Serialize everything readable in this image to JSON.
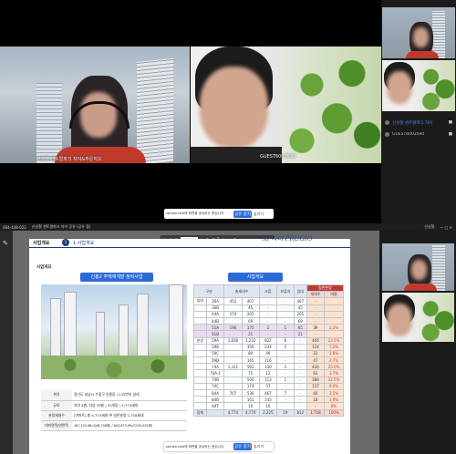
{
  "participants": {
    "main_left": {
      "name": "신성철 센트럴파크 자이&주은지오"
    },
    "main_right": {
      "name": "GUEST6002590"
    }
  },
  "share_toolbar_top": {
    "text": "sptaka-test에 화면을 공유하는 중입니다.",
    "buttons": [
      "공유 중지",
      "숨기기"
    ]
  },
  "share_toolbar_bottom": {
    "text": "sptaka-test에 화면을 공유하는 중입니다.",
    "buttons": [
      "공유 중지",
      "숨기기"
    ]
  },
  "side_panel": {
    "rows": [
      "신성철 센트럴파크 자이",
      "GUEST6002590",
      "GUEST6002590"
    ]
  },
  "lower_window": {
    "phone": "084-448-022",
    "title": "신성철 센트럴파크 자이 공유 (공유 중)",
    "user": "신성철",
    "zoom": "125%"
  },
  "slide": {
    "header_label": "사업개요",
    "header_num": "1",
    "header_title": "1.사업개요",
    "brand": "Xi 자이 PRUGIO",
    "section": "사업개요",
    "left_banner": "신흥2 주택재개발 정비사업",
    "right_banner": "사업개요",
    "info_rows": [
      {
        "k": "위치",
        "v": "경기도 성남시 수정구 신흥동 1132번지 일대"
      },
      {
        "k": "규모",
        "v": "지하 4층, 지상 29층 / 31개동 / 4,774세대"
      },
      {
        "k": "분양세대수",
        "v": "[아파트] 총 4,774세대 中 일반분양 1,718세대"
      },
      {
        "k": "대지면적/연면적",
        "v": "161,152.86㎡(48,748평) / 643,673.99㎡(194,621평)"
      }
    ],
    "table": {
      "headers": [
        "구분",
        "",
        "총세대수",
        "조합",
        "보류지",
        "임대",
        "일반분양",
        "세대수",
        "비율"
      ],
      "rows": [
        [
          "임대",
          "36A",
          "452",
          "407",
          "-",
          "-",
          "407",
          "-",
          ""
        ],
        [
          "",
          "36B",
          "",
          "45",
          "-",
          "-",
          "45",
          "-",
          ""
        ],
        [
          "",
          "44A",
          "274",
          "205",
          "-",
          "-",
          "205",
          "-",
          ""
        ],
        [
          "",
          "44B",
          "",
          "69",
          "-",
          "-",
          "69",
          "-",
          ""
        ],
        [
          "",
          "51A",
          "196",
          "175",
          "2",
          "1",
          "65",
          "39",
          "2.2%"
        ],
        [
          "",
          "51B",
          "",
          "21",
          "-",
          "-",
          "21",
          "-",
          ""
        ],
        [
          "분양",
          "59A",
          "1,836",
          "1,232",
          "822",
          "6",
          "-",
          "406",
          "23.5%"
        ],
        [
          "",
          "59B",
          "",
          "359",
          "233",
          "2",
          "-",
          "124",
          "7.2%"
        ],
        [
          "",
          "59C",
          "",
          "80",
          "49",
          "-",
          "-",
          "31",
          "1.8%"
        ],
        [
          "",
          "59D",
          "",
          "165",
          "116",
          "-",
          "-",
          "47",
          "2.7%"
        ],
        [
          "",
          "74A",
          "1,311",
          "562",
          "130",
          "2",
          "-",
          "430",
          "25.0%"
        ],
        [
          "",
          "74A-1",
          "",
          "75",
          "12",
          "-",
          "-",
          "63",
          "3.7%"
        ],
        [
          "",
          "74B",
          "",
          "500",
          "113",
          "1",
          "-",
          "386",
          "22.5%"
        ],
        [
          "",
          "74C",
          "",
          "174",
          "57",
          "-",
          "-",
          "137",
          "8.0%"
        ],
        [
          "",
          "84A",
          "707",
          "536",
          "467",
          "7",
          "-",
          "60",
          "3.5%"
        ],
        [
          "",
          "84B",
          "",
          "161",
          "143",
          "-",
          "-",
          "18",
          "1.0%"
        ],
        [
          "",
          "84T",
          "",
          "10",
          "10",
          "-",
          "-",
          "-",
          "0%"
        ],
        [
          "합계",
          "",
          "4,774",
          "4,774",
          "2,225",
          "19",
          "812",
          "1,718",
          "100%"
        ]
      ]
    }
  },
  "colors": {
    "accent": "#2d6ad8",
    "purple": "#e9dcef",
    "orange": "#fbe3cf",
    "navy": "#1f3d7a"
  }
}
